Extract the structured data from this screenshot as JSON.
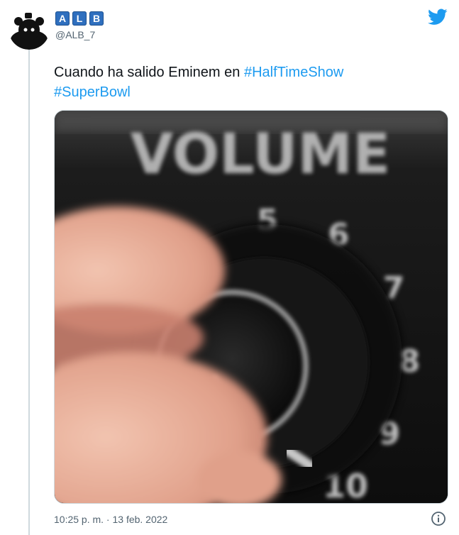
{
  "user": {
    "badges": [
      "A",
      "L",
      "B"
    ],
    "handle": "@ALB_7"
  },
  "tweet": {
    "text_plain": "Cuando ha salido Eminem en ",
    "hashtag_1": "#HalfTimeShow",
    "hashtag_2": "#SuperBowl",
    "timestamp": "10:25 p. m. · 13 feb. 2022"
  },
  "media": {
    "label_volume": "VOLUME",
    "dial_numbers": [
      "5",
      "6",
      "7",
      "8",
      "9",
      "10"
    ],
    "knob_level": 10
  },
  "colors": {
    "accent": "#1d9bf0",
    "badge": "#2f6fbe",
    "muted": "#536471",
    "text": "#0f1419"
  },
  "icons": {
    "logo": "twitter-bird-icon",
    "info": "info-icon"
  }
}
